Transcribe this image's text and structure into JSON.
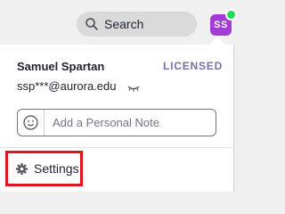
{
  "search": {
    "label": "Search",
    "icon": "search-icon"
  },
  "avatar": {
    "initials": "SS",
    "color": "#a33bd9",
    "status_color": "#23d959"
  },
  "profile": {
    "name": "Samuel Spartan",
    "license": "LICENSED",
    "email": "ssp***@aurora.edu",
    "email_toggle_icon": "eye-closed-icon"
  },
  "note": {
    "placeholder": "Add a Personal Note",
    "emoji_icon": "smiley-icon"
  },
  "menu": {
    "settings_label": "Settings",
    "settings_icon": "gear-icon",
    "highlight_color": "#e0141e"
  }
}
